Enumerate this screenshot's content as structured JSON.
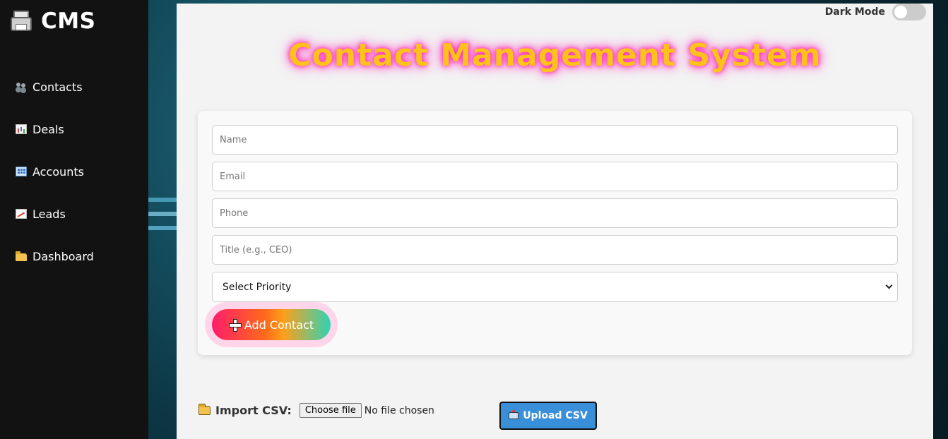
{
  "brand": {
    "title": "CMS",
    "icon": "printer-icon"
  },
  "nav": {
    "items": [
      {
        "label": "Contacts",
        "icon": "contacts-icon"
      },
      {
        "label": "Deals",
        "icon": "bar-chart-icon"
      },
      {
        "label": "Accounts",
        "icon": "building-icon"
      },
      {
        "label": "Leads",
        "icon": "trend-chart-icon"
      },
      {
        "label": "Dashboard",
        "icon": "folder-icon"
      }
    ]
  },
  "header": {
    "dark_mode_label": "Dark Mode",
    "dark_mode_enabled": false,
    "title": "Contact Management System"
  },
  "form": {
    "name_placeholder": "Name",
    "email_placeholder": "Email",
    "phone_placeholder": "Phone",
    "title_placeholder": "Title (e.g., CEO)",
    "priority_selected": "Select Priority",
    "add_button_label": "Add Contact"
  },
  "import": {
    "label": "Import CSV:",
    "choose_file_label": "Choose file",
    "file_status": "No file chosen",
    "upload_button_label": "Upload CSV"
  },
  "colors": {
    "sidebar_bg": "#121212",
    "title_color": "#ffc21a",
    "title_glow": "#ff2fb5",
    "upload_button": "#3a8fd9"
  }
}
